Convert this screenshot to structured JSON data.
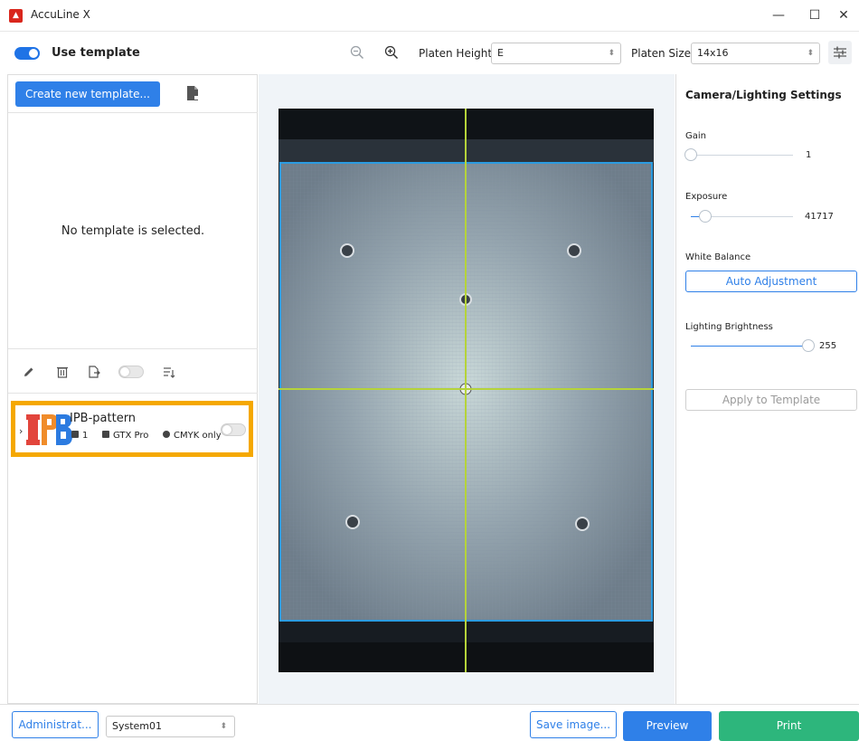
{
  "window": {
    "title": "AccuLine X",
    "logo_icon": "app-logo-icon",
    "controls": {
      "minimize": "—",
      "maximize": "☐",
      "close": "✕"
    }
  },
  "toolbar": {
    "use_template_label": "Use template",
    "use_template_on": true,
    "zoom_out_icon": "zoom-out-icon",
    "zoom_in_icon": "zoom-in-icon",
    "platen_height_label": "Platen Height",
    "platen_height_value": "E",
    "platen_size_label": "Platen Size",
    "platen_size_value": "14x16",
    "settings_icon": "sliders-icon"
  },
  "left_panel": {
    "create_button": "Create new template...",
    "empty_message": "No template is selected.",
    "tools": [
      "pencil-icon",
      "trash-icon",
      "export-icon",
      "toggle",
      "sort-icon"
    ],
    "template": {
      "name": "IPB-pattern",
      "count": "1",
      "printer": "GTX Pro",
      "ink_mode": "CMYK only",
      "enabled": false
    }
  },
  "right_panel": {
    "title": "Camera/Lighting Settings",
    "gain": {
      "label": "Gain",
      "value": "1"
    },
    "exposure": {
      "label": "Exposure",
      "value": "41717"
    },
    "white_balance": {
      "label": "White Balance",
      "button": "Auto Adjustment"
    },
    "lighting": {
      "label": "Lighting Brightness",
      "value": "255"
    },
    "apply_button": "Apply to Template"
  },
  "bottom": {
    "admin_button": "Administrat...",
    "system_value": "System01",
    "save_button": "Save image...",
    "preview_button": "Preview",
    "print_button": "Print"
  },
  "colors": {
    "accent": "#2f80e8",
    "print": "#2db67c",
    "highlight": "#f5a800",
    "crosshair": "#b5d33a",
    "print_area": "#2b9be0"
  }
}
